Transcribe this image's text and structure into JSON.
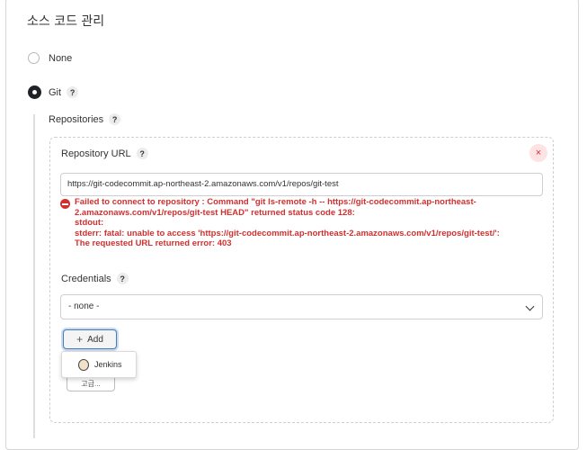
{
  "section": {
    "title": "소스 코드 관리"
  },
  "scm": {
    "options": [
      {
        "label": "None",
        "selected": false
      },
      {
        "label": "Git",
        "selected": true
      }
    ],
    "help_glyph": "?"
  },
  "repositories": {
    "label": "Repositories",
    "repository_url": {
      "label": "Repository URL",
      "value": "https://git-codecommit.ap-northeast-2.amazonaws.com/v1/repos/git-test"
    },
    "close_glyph": "×",
    "error_lines": [
      "Failed to connect to repository : Command \"git ls-remote -h -- https://git-codecommit.ap-northeast-",
      "2.amazonaws.com/v1/repos/git-test HEAD\" returned status code 128:",
      "stdout:",
      "stderr: fatal: unable to access 'https://git-codecommit.ap-northeast-2.amazonaws.com/v1/repos/git-test/':",
      "The requested URL returned error: 403"
    ],
    "credentials": {
      "label": "Credentials",
      "selected": "- none -",
      "add_label": "Add",
      "add_glyph": "+",
      "dropdown_item": "Jenkins",
      "advanced_label": "고급..."
    }
  },
  "colors": {
    "error": "#d32f2f",
    "accent_border": "#4a7bb6"
  },
  "icons": [
    "help-icon",
    "close-icon",
    "error-icon",
    "chevron-down-icon",
    "plus-icon",
    "jenkins-icon"
  ]
}
